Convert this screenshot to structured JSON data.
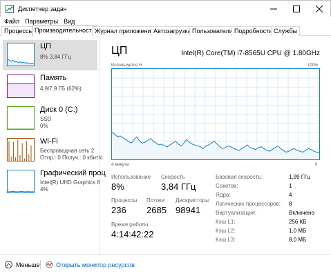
{
  "window": {
    "title": "Диспетчер задач",
    "minimize": "—",
    "maximize": "☐",
    "close": "✕"
  },
  "menu": [
    "Файл",
    "Параметры",
    "Вид"
  ],
  "tabs": [
    {
      "label": "Процессы"
    },
    {
      "label": "Производительность",
      "active": true
    },
    {
      "label": "Журнал приложений"
    },
    {
      "label": "Автозагрузка"
    },
    {
      "label": "Пользователи"
    },
    {
      "label": "Подробности"
    },
    {
      "label": "Службы"
    }
  ],
  "sidebar": {
    "items": [
      {
        "title": "ЦП",
        "sub1": "8% 3,84 ГГц",
        "sub2": "",
        "color": "#1182d6",
        "selected": true
      },
      {
        "title": "Память",
        "sub1": "4,9/7,9 ГБ (62%)",
        "sub2": "",
        "color": "#8b12ae"
      },
      {
        "title": "Диск 0 (C:)",
        "sub1": "SSD",
        "sub2": "0%",
        "color": "#4da60c"
      },
      {
        "title": "Wi-Fi",
        "sub1": "Беспроводная сеть 2",
        "sub2": "Отпр.: 0 Получ.: 0 кбит/с",
        "color": "#a74f01"
      },
      {
        "title": "Графический проц",
        "sub1": "Intel(R) UHD Graphics 6",
        "sub2": "4%",
        "color": "#1182d6"
      }
    ]
  },
  "main": {
    "title": "ЦП",
    "cpu_model": "Intel(R) Core(TM) i7-8565U CPU @ 1.80GHz",
    "util_label": "Используется %",
    "util_max": "100%",
    "time_label": "4 минуты",
    "zero_label": "0",
    "stats": {
      "usage_label": "Использование",
      "usage": "8%",
      "speed_label": "Скорость",
      "speed": "3,84 ГГц",
      "processes_label": "Процессы",
      "processes": "236",
      "threads_label": "Потоки",
      "threads": "2685",
      "handles_label": "Дескрипторы",
      "handles": "98941",
      "uptime_label": "Время работы",
      "uptime": "4:14:42:22"
    },
    "details": [
      {
        "k": "Базовая скорость:",
        "v": "1,99 ГГц"
      },
      {
        "k": "Сокетов:",
        "v": "1"
      },
      {
        "k": "Ядра:",
        "v": "4"
      },
      {
        "k": "Логических процессоров:",
        "v": "8"
      },
      {
        "k": "Виртуализация:",
        "v": "Включено"
      },
      {
        "k": "Кэш L1:",
        "v": "256 КБ"
      },
      {
        "k": "Кэш L2:",
        "v": "1,0 МБ"
      },
      {
        "k": "Кэш L3:",
        "v": "8,0 МБ"
      }
    ]
  },
  "bottom": {
    "less_label": "Меньше",
    "resmon_label": "Открыть монитор ресурсов"
  },
  "graph_data": {
    "cpu": [
      30,
      28,
      25,
      26,
      24,
      22,
      20,
      18,
      22,
      25,
      20,
      18,
      19,
      21,
      23,
      20,
      18,
      16,
      17,
      15,
      14,
      16,
      18,
      20,
      17,
      15,
      18,
      22,
      19,
      17,
      16,
      15,
      14,
      12,
      15,
      16,
      18,
      20,
      17,
      14,
      12,
      13,
      15,
      14,
      12,
      11,
      10,
      12,
      14,
      16,
      13,
      12,
      11,
      13,
      14,
      12,
      10,
      9,
      11,
      13,
      15,
      12,
      10,
      8,
      9,
      11,
      12,
      10,
      9,
      8,
      10,
      12,
      11,
      9,
      8,
      7
    ],
    "thumb_cpu": [
      30,
      25,
      22,
      20,
      24,
      18,
      16,
      20,
      15,
      14,
      17,
      12,
      15,
      13,
      11,
      14,
      10,
      12,
      9,
      11,
      8,
      10
    ],
    "thumb_mem": [
      62,
      62,
      62,
      62,
      62,
      62,
      62,
      62,
      62,
      62,
      62,
      62
    ],
    "thumb_disk": [
      0,
      0,
      0,
      0,
      0,
      0,
      0,
      0,
      0,
      0,
      0,
      0
    ],
    "thumb_gpu": [
      4,
      3,
      5,
      4,
      3,
      4,
      5,
      3,
      4,
      4,
      3,
      4
    ]
  }
}
